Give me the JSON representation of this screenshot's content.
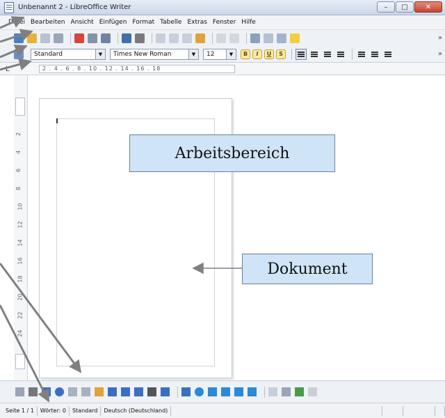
{
  "window": {
    "title": "Unbenannt 2 - LibreOffice Writer",
    "controls": {
      "minimize": "–",
      "maximize": "□",
      "close": "✕"
    }
  },
  "menubar": {
    "items": [
      "Datei",
      "Bearbeiten",
      "Ansicht",
      "Einfügen",
      "Format",
      "Tabelle",
      "Extras",
      "Fenster",
      "Hilfe"
    ]
  },
  "toolbar_format": {
    "paragraph_style": "Standard",
    "font_name": "Times New Roman",
    "font_size": "12",
    "more_label": "»"
  },
  "toolbar_standard": {
    "more_label": "»"
  },
  "ruler": {
    "tab_symbol": "L",
    "scale_text": "2 . 4 . 6 . 8 . 10 . 12 . 14 . 16 . 18"
  },
  "vruler": {
    "numbers": [
      "2",
      "4",
      "6",
      "8",
      "10",
      "12",
      "14",
      "16",
      "18",
      "20",
      "22",
      "24"
    ]
  },
  "annotations": {
    "workarea_label": "Arbeitsbereich",
    "document_label": "Dokument"
  },
  "statusbar": {
    "page": "Seite 1 / 1",
    "words": "Wörter: 0",
    "style": "Standard",
    "language": "Deutsch (Deutschland)"
  },
  "colors": {
    "callout_bg": "#cfe4f6",
    "arrow": "#808080"
  }
}
